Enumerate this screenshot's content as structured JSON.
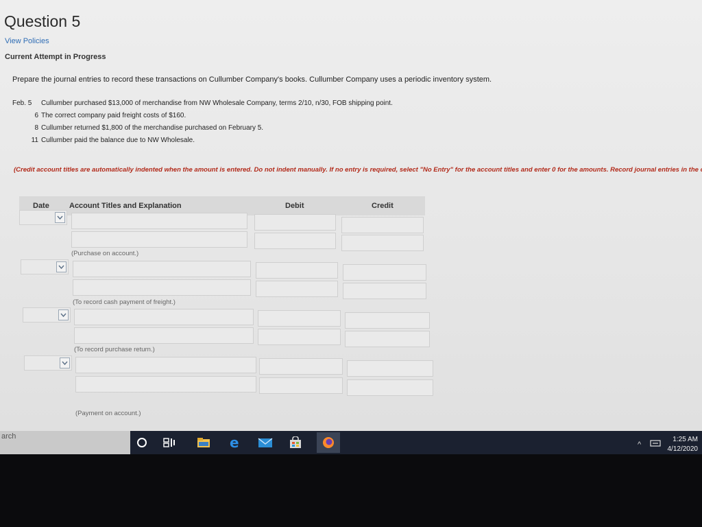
{
  "page": {
    "title": "Question 5",
    "policies_link": "View Policies",
    "attempt_status": "Current Attempt in Progress",
    "prompt": "Prepare the journal entries to record these transactions on Cullumber Company's books. Cullumber Company uses a periodic inventory system."
  },
  "transactions": [
    {
      "date": "Feb. 5",
      "text": "Cullumber purchased $13,000 of merchandise from NW Wholesale Company, terms 2/10, n/30, FOB shipping point."
    },
    {
      "date": "6",
      "text": "The correct company paid freight costs of $160."
    },
    {
      "date": "8",
      "text": "Cullumber returned $1,800 of the merchandise purchased on February 5."
    },
    {
      "date": "11",
      "text": "Cullumber paid the balance due to NW Wholesale."
    }
  ],
  "instructions": "(Credit account titles are automatically indented when the amount is entered. Do not indent manually. If no entry is required, select \"No Entry\" for the account titles and enter 0 for the amounts. Record journal entries in the order presented in the problem.)",
  "table": {
    "headers": {
      "date": "Date",
      "account": "Account Titles and Explanation",
      "debit": "Debit",
      "credit": "Credit"
    },
    "memos": [
      "(Purchase on account.)",
      "(To record cash payment of freight.)",
      "(To record purchase return.)",
      "(Payment on account.)"
    ]
  },
  "taskbar": {
    "search_text": "arch",
    "time": "1:25 AM",
    "date": "4/12/2020"
  }
}
